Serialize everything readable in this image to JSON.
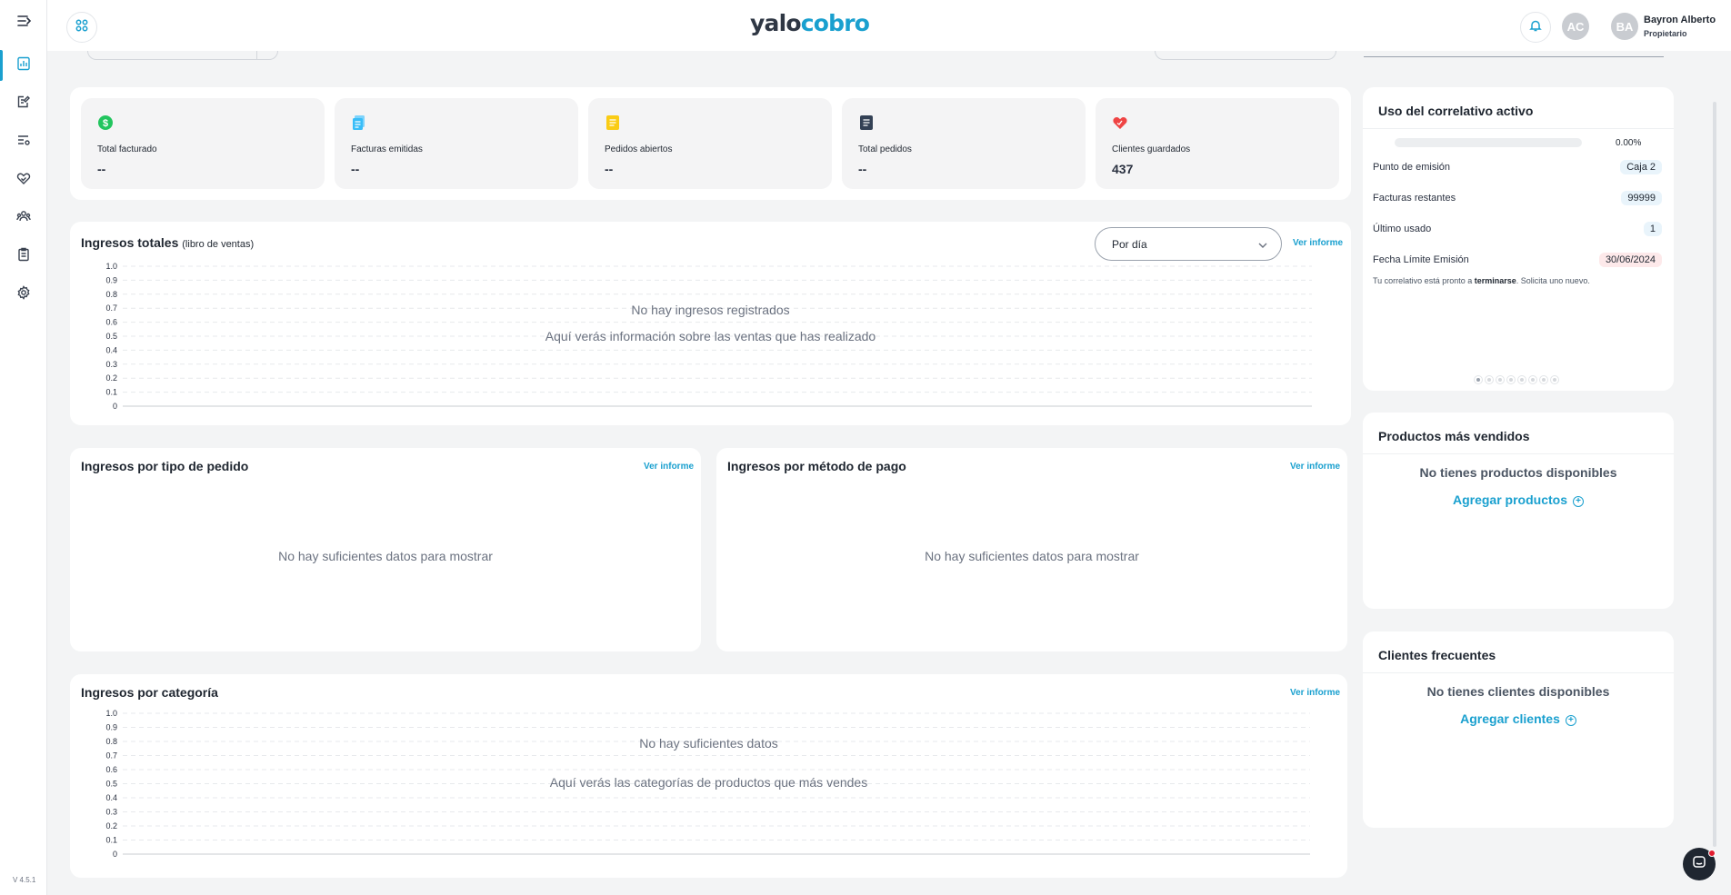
{
  "app": {
    "logo_part1": "yalo",
    "logo_part2": "cobro",
    "version": "V 4.5.1",
    "accent_color": "#1aa0cf"
  },
  "sidebar": {
    "items": [
      {
        "icon": "report-chart-icon",
        "active": true
      },
      {
        "icon": "edit-document-icon",
        "active": false
      },
      {
        "icon": "list-settings-icon",
        "active": false
      },
      {
        "icon": "heart-handshake-icon",
        "active": false
      },
      {
        "icon": "users-icon",
        "active": false
      },
      {
        "icon": "clipboard-icon",
        "active": false
      },
      {
        "icon": "gear-icon",
        "active": false
      }
    ]
  },
  "header": {
    "avatar1_initials": "AC",
    "avatar2_initials": "BA",
    "user_name": "Bayron Alberto",
    "user_role": "Propietario"
  },
  "stats": [
    {
      "label": "Total facturado",
      "value": "--",
      "icon": "dollar-icon",
      "color": "#22c55e"
    },
    {
      "label": "Facturas emitidas",
      "value": "--",
      "icon": "documents-icon",
      "color": "#38bdf8"
    },
    {
      "label": "Pedidos abiertos",
      "value": "--",
      "icon": "order-icon",
      "color": "#facc15"
    },
    {
      "label": "Total pedidos",
      "value": "--",
      "icon": "list-icon",
      "color": "#334155"
    },
    {
      "label": "Clientes guardados",
      "value": "437",
      "icon": "heart-icon",
      "color": "#ef4444"
    }
  ],
  "income_total": {
    "title": "Ingresos totales",
    "subtitle": "(libro de ventas)",
    "period_selected": "Por día",
    "report_link": "Ver informe",
    "empty_title": "No hay ingresos registrados",
    "empty_desc": "Aquí verás información sobre las ventas que has realizado"
  },
  "income_by_order_type": {
    "title": "Ingresos por tipo de pedido",
    "report_link": "Ver informe",
    "empty": "No hay suficientes datos para mostrar"
  },
  "income_by_payment": {
    "title": "Ingresos por método de pago",
    "report_link": "Ver informe",
    "empty": "No hay suficientes datos para mostrar"
  },
  "income_by_category": {
    "title": "Ingresos por categoría",
    "report_link": "Ver informe",
    "empty_title": "No hay suficientes datos",
    "empty_desc": "Aquí verás las categorías de productos que más vendes"
  },
  "correlative": {
    "title": "Uso del correlativo activo",
    "progress_percent": 0,
    "progress_label": "0.00%",
    "rows": [
      {
        "key": "Punto de emisión",
        "value": "Caja 2"
      },
      {
        "key": "Facturas restantes",
        "value": "99999"
      },
      {
        "key": "Último usado",
        "value": "1"
      },
      {
        "key": "Fecha Límite Emisión",
        "value": "30/06/2024"
      }
    ],
    "note_prefix": "Tu correlativo está pronto a ",
    "note_bold": "terminarse",
    "note_suffix": ". Solicita uno nuevo.",
    "dots_count": 8,
    "active_dot": 0
  },
  "top_products": {
    "title": "Productos más vendidos",
    "empty": "No tienes productos disponibles",
    "cta": "Agregar productos"
  },
  "frequent_clients": {
    "title": "Clientes frecuentes",
    "empty": "No tienes clientes disponibles",
    "cta": "Agregar clientes"
  },
  "chart_data": [
    {
      "type": "line",
      "title": "Ingresos totales",
      "series": [],
      "y_ticks": [
        "0",
        "0.1",
        "0.2",
        "0.3",
        "0.4",
        "0.5",
        "0.6",
        "0.7",
        "0.8",
        "0.9",
        "1.0"
      ],
      "ylim": [
        0,
        1.0
      ],
      "grid": true
    },
    {
      "type": "bar",
      "title": "Ingresos por categoría",
      "series": [],
      "y_ticks": [
        "0",
        "0.1",
        "0.2",
        "0.3",
        "0.4",
        "0.5",
        "0.6",
        "0.7",
        "0.8",
        "0.9",
        "1.0"
      ],
      "ylim": [
        0,
        1.0
      ],
      "grid": true
    }
  ]
}
